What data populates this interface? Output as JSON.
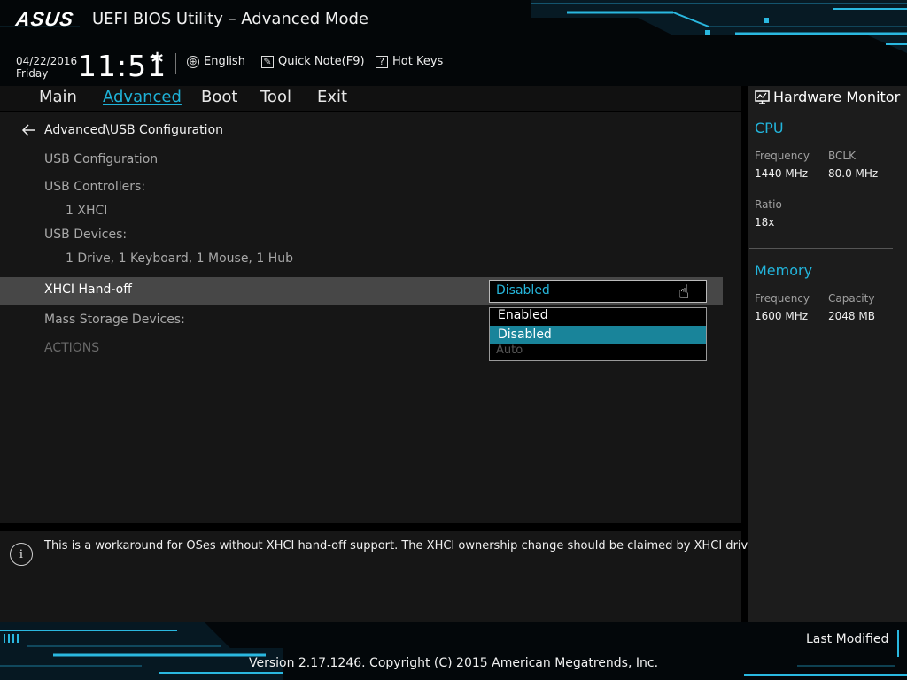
{
  "header": {
    "logo": "ASUS",
    "title": "UEFI BIOS Utility – Advanced Mode",
    "date": "04/22/2016",
    "day": "Friday",
    "time": "11:51",
    "language": "English",
    "quick_note": "Quick Note(F9)",
    "hot_keys": "Hot Keys"
  },
  "nav": {
    "tabs": [
      {
        "label": "Main"
      },
      {
        "label": "Advanced"
      },
      {
        "label": "Boot"
      },
      {
        "label": "Tool"
      },
      {
        "label": "Exit"
      }
    ],
    "active": "Advanced"
  },
  "main": {
    "breadcrumb": "Advanced\\USB Configuration",
    "items": {
      "usb_config": "USB Configuration",
      "usb_controllers": "USB Controllers:",
      "usb_controllers_value": "1 XHCI",
      "usb_devices": "USB Devices:",
      "usb_devices_value": "1 Drive, 1 Keyboard, 1 Mouse, 1 Hub",
      "xhci_handoff": "XHCI Hand-off",
      "mass_storage": "Mass Storage Devices:",
      "actions": "ACTIONS"
    },
    "xhci_select": {
      "value": "Disabled",
      "options": [
        "Enabled",
        "Disabled"
      ],
      "hidden_option": "Auto"
    }
  },
  "help": {
    "text": "This is a workaround for OSes without XHCI hand-off support. The XHCI ownership change should be claimed by XHCI driver."
  },
  "hardware_monitor": {
    "title": "Hardware Monitor",
    "cpu": {
      "label": "CPU",
      "frequency_label": "Frequency",
      "frequency": "1440 MHz",
      "bclk_label": "BCLK",
      "bclk": "80.0 MHz",
      "ratio_label": "Ratio",
      "ratio": "18x"
    },
    "memory": {
      "label": "Memory",
      "frequency_label": "Frequency",
      "frequency": "1600 MHz",
      "capacity_label": "Capacity",
      "capacity": "2048 MB"
    }
  },
  "footer": {
    "version": "Version 2.17.1246. Copyright (C) 2015 American Megatrends, Inc.",
    "last_modified": "Last Modified"
  },
  "colors": {
    "accent": "#1fb2d8",
    "selected_option": "#19849a",
    "row_highlight": "#474747"
  }
}
